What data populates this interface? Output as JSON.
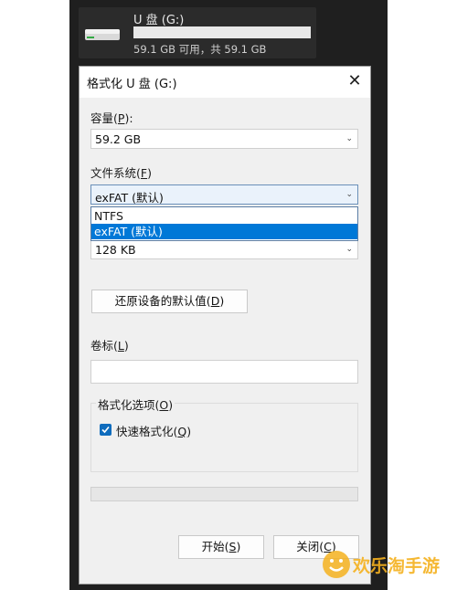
{
  "drive": {
    "name": "U 盘 (G:)",
    "info": "59.1 GB 可用，共 59.1 GB",
    "used_fraction": 0.0
  },
  "dialog": {
    "title": "格式化 U 盘 (G:)",
    "capacity": {
      "label": "容量",
      "accel": "P",
      "value": "59.2 GB"
    },
    "filesystem": {
      "label": "文件系统",
      "accel": "F",
      "value": "exFAT (默认)",
      "options": [
        "NTFS",
        "exFAT (默认)"
      ],
      "selected_index": 1
    },
    "allocation": {
      "value": "128 KB"
    },
    "restore_defaults": {
      "label": "还原设备的默认值",
      "accel": "D"
    },
    "volume_label": {
      "label": "卷标",
      "accel": "L",
      "value": ""
    },
    "format_options": {
      "label": "格式化选项",
      "accel": "O",
      "quick_format": {
        "label": "快速格式化",
        "accel": "Q",
        "checked": true
      }
    },
    "progress": 0,
    "start_button": {
      "label": "开始",
      "accel": "S"
    },
    "close_button": {
      "label": "关闭",
      "accel": "C"
    }
  },
  "watermark": {
    "text": "欢乐淘手游"
  },
  "colors": {
    "accent": "#0078d7",
    "dark_bg": "#1f1f1f",
    "dialog_bg": "#f0f0f0"
  }
}
